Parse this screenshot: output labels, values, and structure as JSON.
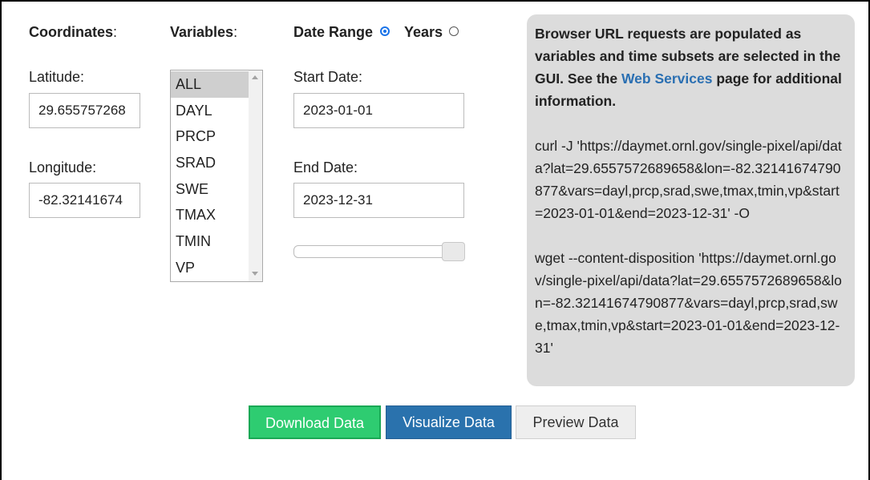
{
  "headers": {
    "coordinates": "Coordinates",
    "coordinates_colon": ":",
    "variables": "Variables",
    "variables_colon": ":",
    "date_range": "Date Range",
    "years": "Years"
  },
  "coordinates": {
    "latitude_label": "Latitude:",
    "latitude_value": "29.655757268",
    "longitude_label": "Longitude:",
    "longitude_value": "-82.32141674"
  },
  "variables": {
    "items": [
      "ALL",
      "DAYL",
      "PRCP",
      "SRAD",
      "SWE",
      "TMAX",
      "TMIN",
      "VP"
    ],
    "selected": "ALL"
  },
  "dates": {
    "start_label": "Start Date:",
    "start_value": "2023-01-01",
    "end_label": "End Date:",
    "end_value": "2023-12-31",
    "date_range_selected": true,
    "slider_value": 1.0
  },
  "info": {
    "intro_before_link": "Browser URL requests are populated as variables and time subsets are selected in the GUI. See the ",
    "link_text": "Web Services",
    "intro_after_link": " page for additional information.",
    "curl": "curl -J 'https://daymet.ornl.gov/single-pixel/api/data?lat=29.6557572689658&lon=-82.32141674790877&vars=dayl,prcp,srad,swe,tmax,tmin,vp&start=2023-01-01&end=2023-12-31' -O",
    "wget": "wget --content-disposition 'https://daymet.ornl.gov/single-pixel/api/data?lat=29.6557572689658&lon=-82.32141674790877&vars=dayl,prcp,srad,swe,tmax,tmin,vp&start=2023-01-01&end=2023-12-31'"
  },
  "buttons": {
    "download": "Download Data",
    "visualize": "Visualize Data",
    "preview": "Preview Data"
  },
  "colors": {
    "download_bg": "#2ecc71",
    "visualize_bg": "#2a72ad",
    "preview_bg": "#eeeeee",
    "link": "#2a6fb2",
    "radio_accent": "#1a73e8",
    "panel_bg": "#dcdcdc"
  },
  "icons": {
    "radio_checked": "radio-checked-icon",
    "radio_unchecked": "radio-unchecked-icon",
    "scroll_up": "scroll-up-arrow-icon",
    "scroll_down": "scroll-down-arrow-icon"
  }
}
